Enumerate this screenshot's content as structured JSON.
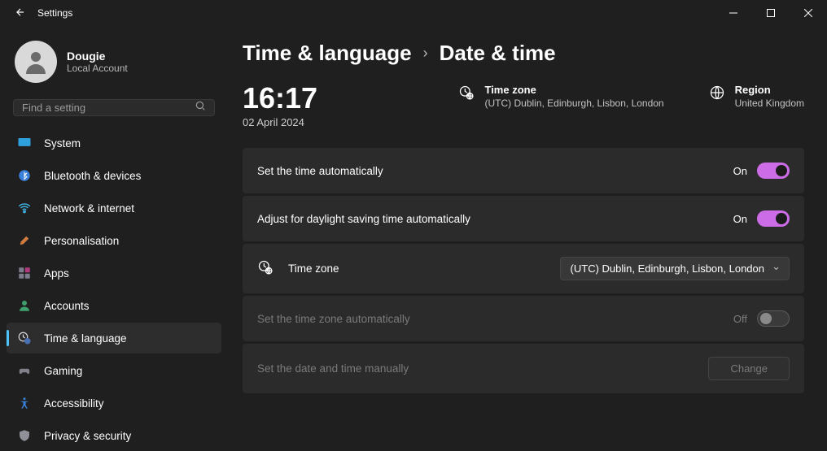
{
  "window": {
    "title": "Settings"
  },
  "profile": {
    "name": "Dougie",
    "sub": "Local Account"
  },
  "search": {
    "placeholder": "Find a setting"
  },
  "nav": [
    {
      "id": "system",
      "label": "System"
    },
    {
      "id": "bluetooth",
      "label": "Bluetooth & devices"
    },
    {
      "id": "network",
      "label": "Network & internet"
    },
    {
      "id": "personalisation",
      "label": "Personalisation"
    },
    {
      "id": "apps",
      "label": "Apps"
    },
    {
      "id": "accounts",
      "label": "Accounts"
    },
    {
      "id": "timelang",
      "label": "Time & language"
    },
    {
      "id": "gaming",
      "label": "Gaming"
    },
    {
      "id": "accessibility",
      "label": "Accessibility"
    },
    {
      "id": "privacy",
      "label": "Privacy & security"
    }
  ],
  "breadcrumb": {
    "parent": "Time & language",
    "current": "Date & time"
  },
  "clock": {
    "time": "16:17",
    "date": "02 April 2024"
  },
  "timezone": {
    "title": "Time zone",
    "value": "(UTC) Dublin, Edinburgh, Lisbon, London"
  },
  "region": {
    "title": "Region",
    "value": "United Kingdom"
  },
  "settings": {
    "auto_time": {
      "label": "Set the time automatically",
      "state": "On"
    },
    "dst": {
      "label": "Adjust for daylight saving time automatically",
      "state": "On"
    },
    "tz": {
      "label": "Time zone",
      "value": "(UTC) Dublin, Edinburgh, Lisbon, London"
    },
    "auto_tz": {
      "label": "Set the time zone automatically",
      "state": "Off"
    },
    "manual": {
      "label": "Set the date and time manually",
      "button": "Change"
    }
  }
}
